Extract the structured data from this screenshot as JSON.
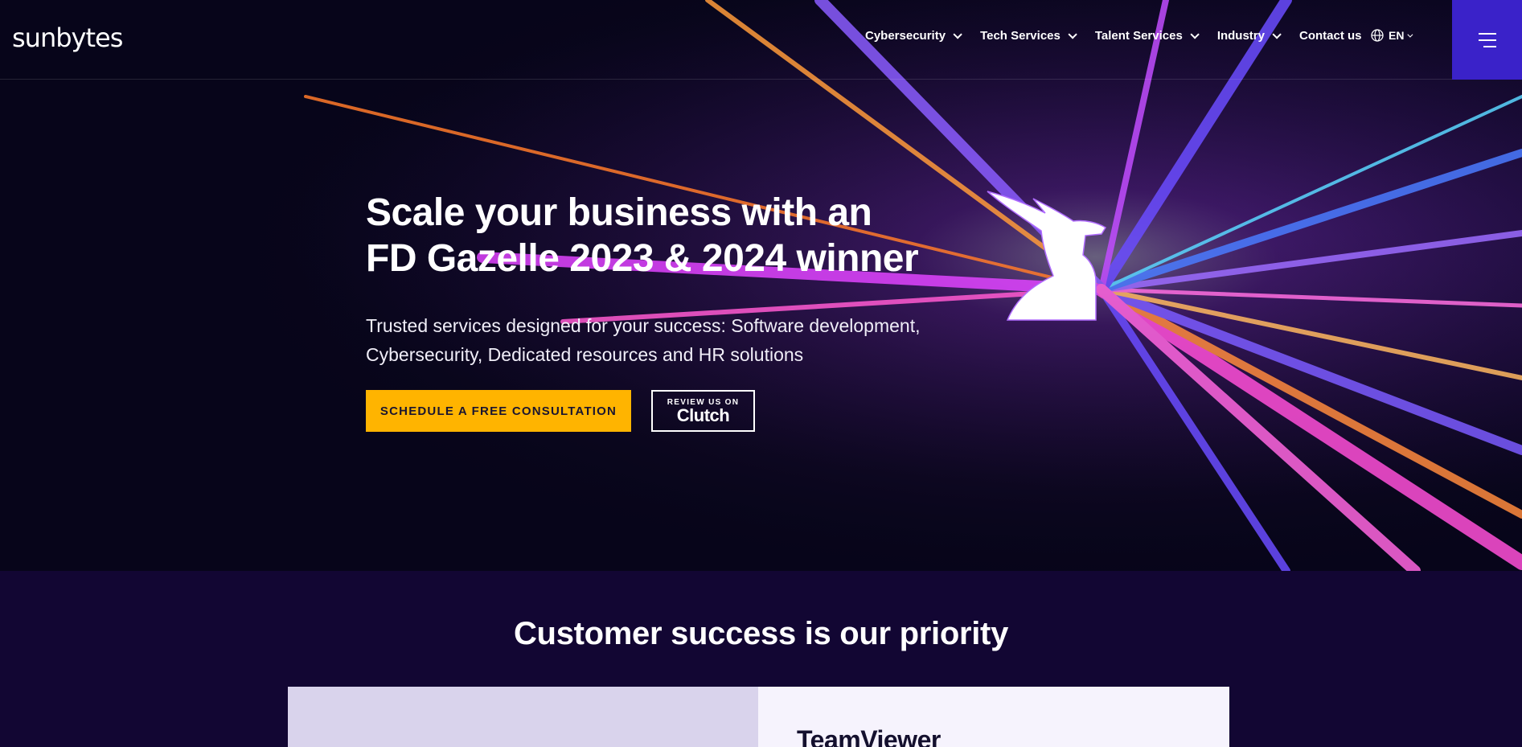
{
  "header": {
    "logo": "sunbytes",
    "nav": [
      {
        "label": "Cybersecurity"
      },
      {
        "label": "Tech Services"
      },
      {
        "label": "Talent Services"
      },
      {
        "label": "Industry"
      },
      {
        "label": "Contact us"
      }
    ],
    "language": "EN"
  },
  "hero": {
    "title_line1": "Scale your business with an",
    "title_line2": "FD Gazelle 2023 & 2024 winner",
    "subtitle_line1": "Trusted services designed for your success: Software development,",
    "subtitle_line2": "Cybersecurity, Dedicated resources and HR solutions",
    "cta_label": "SCHEDULE A FREE CONSULTATION",
    "clutch_small": "REVIEW US ON",
    "clutch_big": "Clutch"
  },
  "section": {
    "title": "Customer success is our priority",
    "card_name": "TeamViewer"
  },
  "colors": {
    "accent": "#ffb400",
    "menu_bg": "#3a22c9",
    "section_bg": "#120633"
  },
  "icons": [
    "chevron-down-icon",
    "globe-icon",
    "hamburger-menu-icon",
    "gazelle-logo-icon"
  ]
}
